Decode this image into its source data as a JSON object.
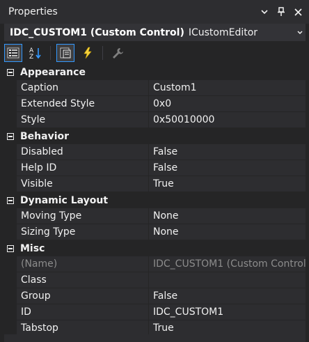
{
  "window": {
    "title": "Properties"
  },
  "selector": {
    "object_name": "IDC_CUSTOM1 (Custom Control)",
    "object_type": "ICustomEditor"
  },
  "toolbar": {
    "active_index": 0
  },
  "categories": [
    {
      "label": "Appearance",
      "rows": [
        {
          "name": "Caption",
          "value": "Custom1"
        },
        {
          "name": "Extended Style",
          "value": "0x0"
        },
        {
          "name": "Style",
          "value": "0x50010000"
        }
      ]
    },
    {
      "label": "Behavior",
      "rows": [
        {
          "name": "Disabled",
          "value": "False"
        },
        {
          "name": "Help ID",
          "value": "False"
        },
        {
          "name": "Visible",
          "value": "True"
        }
      ]
    },
    {
      "label": "Dynamic Layout",
      "rows": [
        {
          "name": "Moving Type",
          "value": "None"
        },
        {
          "name": "Sizing Type",
          "value": "None"
        }
      ]
    },
    {
      "label": "Misc",
      "rows": [
        {
          "name": "(Name)",
          "value": "IDC_CUSTOM1 (Custom Control)",
          "readonly": true
        },
        {
          "name": "Class",
          "value": ""
        },
        {
          "name": "Group",
          "value": "False"
        },
        {
          "name": "ID",
          "value": "IDC_CUSTOM1"
        },
        {
          "name": "Tabstop",
          "value": "True"
        }
      ]
    }
  ],
  "colors": {
    "background": "#252526",
    "cell": "#2d2d30",
    "accent": "#3399ff",
    "text": "#f1f1f1",
    "readonly_text": "#8c8c8c"
  }
}
